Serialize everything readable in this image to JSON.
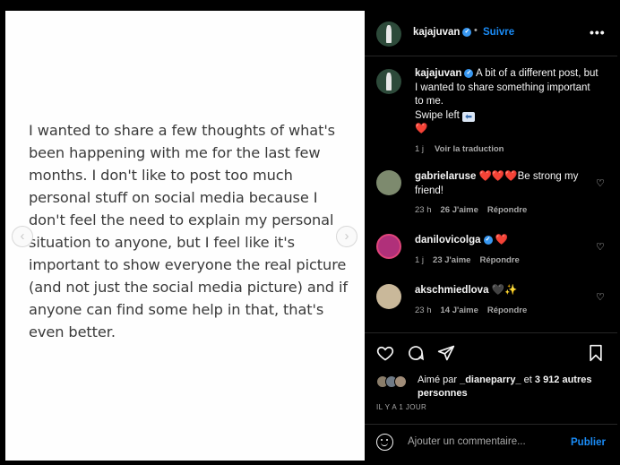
{
  "post_image": {
    "text_lines": [
      "I wanted to share a few thoughts of what's",
      "been happening with me for the last few",
      "months. I don't like to post too much",
      "personal stuff on social media because I",
      "don't feel the need to explain my personal",
      "situation to anyone, but I feel like it's",
      "important to show everyone the real picture",
      "(and not just the social media picture) and if",
      "anyone can find some help in that, that's",
      "even better."
    ],
    "prev_icon": "chevron-left-icon",
    "next_icon": "chevron-right-icon"
  },
  "header": {
    "username": "kajajuvan",
    "separator": "•",
    "follow_label": "Suivre",
    "more_icon": "more-horizontal-icon"
  },
  "caption": {
    "username": "kajajuvan",
    "text_1": "A bit of a different post, but I wanted to share something important to me.",
    "text_2": "Swipe left",
    "emoji_arrow": "⬅",
    "emoji_heart": "❤️",
    "time": "1 j",
    "translate_label": "Voir la traduction"
  },
  "comments": [
    {
      "username": "gabrielaruse",
      "text": "❤️❤️❤️Be strong my friend!",
      "time": "23 h",
      "likes": "26 J'aime",
      "reply": "Répondre"
    },
    {
      "username": "danilovicolga",
      "text": "❤️",
      "time": "1 j",
      "likes": "23 J'aime",
      "reply": "Répondre"
    },
    {
      "username": "akschmiedlova",
      "text": "🖤✨",
      "time": "23 h",
      "likes": "14 J'aime",
      "reply": "Répondre"
    }
  ],
  "actions": {
    "like_icon": "heart-outline-icon",
    "comment_icon": "comment-icon",
    "share_icon": "share-icon",
    "save_icon": "bookmark-icon"
  },
  "likes": {
    "prefix": "Aimé par",
    "user": "_dianeparry_",
    "connector": "et",
    "others": "3 912 autres personnes"
  },
  "time_ago": "IL Y A 1 JOUR",
  "add_comment": {
    "placeholder": "Ajouter un commentaire...",
    "publish_label": "Publier",
    "emoji_icon": "smiley-icon"
  },
  "colors": {
    "accent": "#1a8cf7",
    "verified": "#3897f0",
    "background": "#000000",
    "muted": "#a8a8a8",
    "heart": "#ed4956"
  }
}
